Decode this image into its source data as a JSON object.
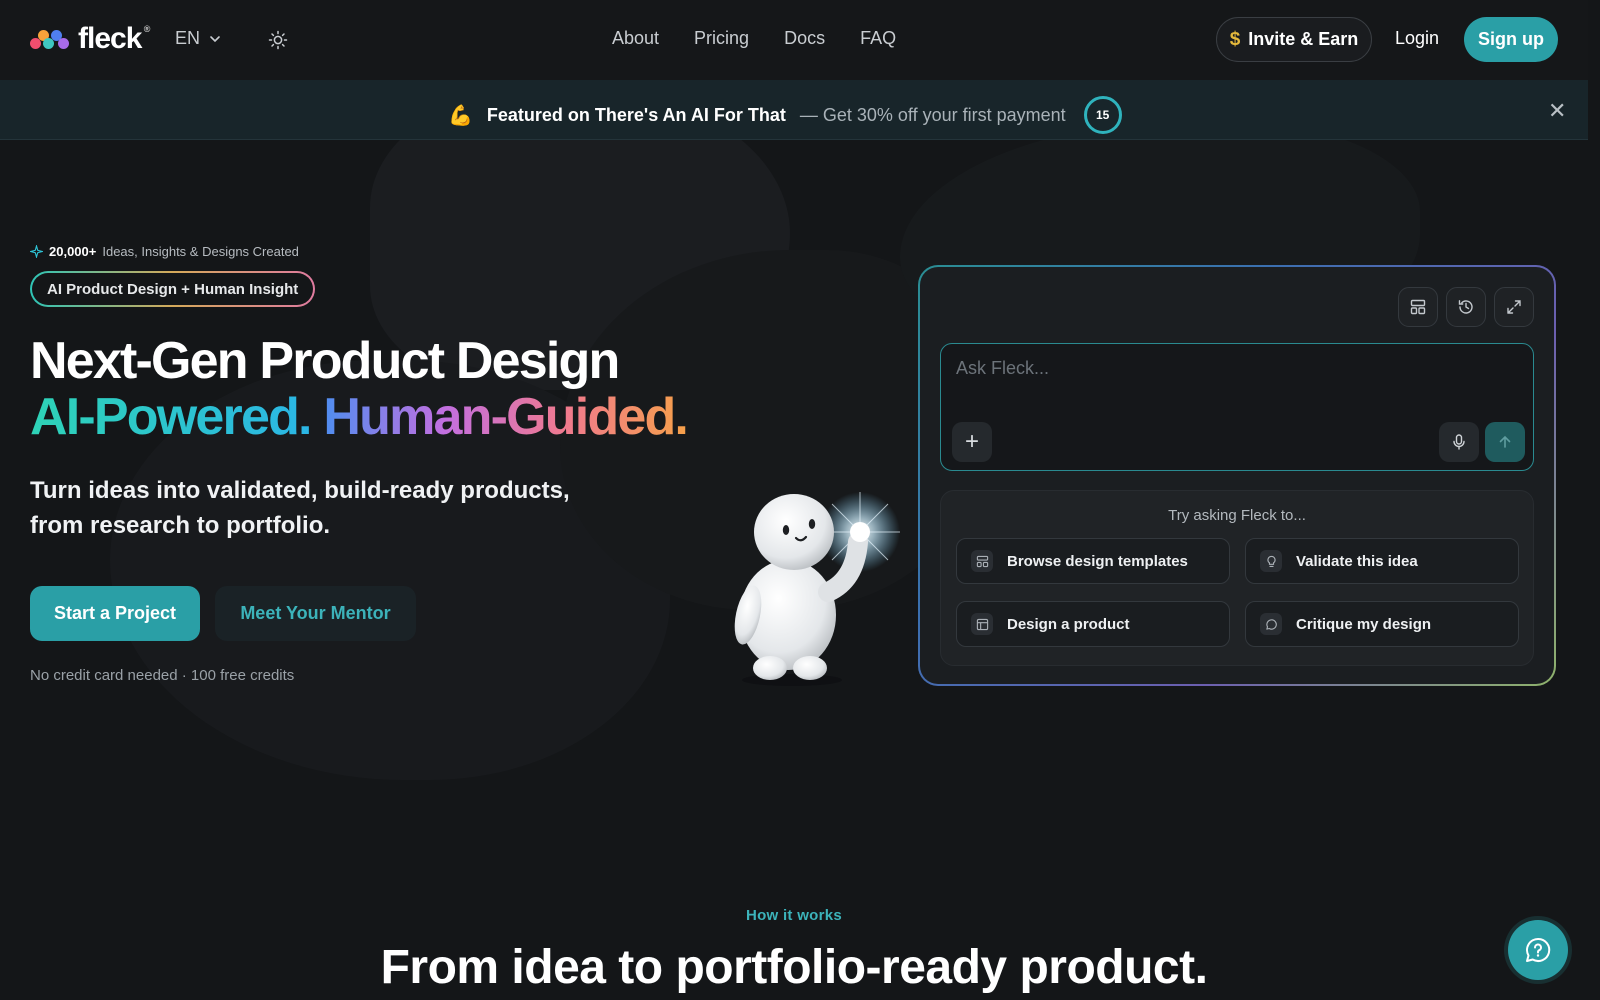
{
  "brand": {
    "name": "fleck",
    "reg": "®",
    "accent": "#2a9fa6"
  },
  "nav": {
    "language": "EN",
    "links": [
      "About",
      "Pricing",
      "Docs",
      "FAQ"
    ],
    "invite_label": "Invite & Earn",
    "invite_symbol": "$",
    "login_label": "Login",
    "signup_label": "Sign up"
  },
  "banner": {
    "emoji": "💪",
    "title": "Featured on There's An AI For That",
    "subtitle": "— Get 30% off your first payment",
    "countdown": "15"
  },
  "hero": {
    "stat_count": "20,000+",
    "stat_text": "Ideas, Insights & Designs Created",
    "pill": "AI Product Design + Human Insight",
    "title_line1": "Next-Gen Product Design",
    "title_part_a": "AI-Powered.",
    "title_part_b": "Human-Guided.",
    "subtitle": "Turn ideas into validated, build-ready products, from research to portfolio.",
    "primary_cta": "Start a Project",
    "secondary_cta": "Meet Your Mentor",
    "fineprint": "No credit card needed · 100 free credits"
  },
  "chat": {
    "placeholder": "Ask Fleck...",
    "suggest_title": "Try asking Fleck to...",
    "suggestions": [
      {
        "label": "Browse design templates",
        "icon": "template-icon"
      },
      {
        "label": "Validate this idea",
        "icon": "lightbulb-icon"
      },
      {
        "label": "Design a product",
        "icon": "layout-icon"
      },
      {
        "label": "Critique my design",
        "icon": "chat-bubble-icon"
      }
    ]
  },
  "how": {
    "label": "How it works",
    "title": "From idea to portfolio-ready product."
  }
}
